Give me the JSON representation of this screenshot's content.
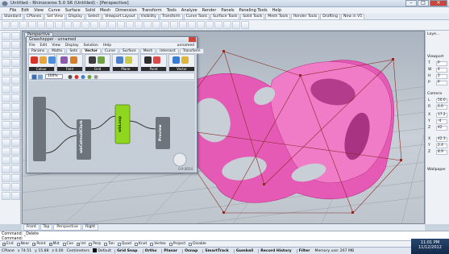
{
  "window": {
    "title": "Untitled - Rhinoceros 5.0 SR (Untitled) - [Perspective]",
    "controls": [
      "–",
      "□",
      "✕"
    ]
  },
  "menubar": [
    "File",
    "Edit",
    "View",
    "Curve",
    "Surface",
    "Solid",
    "Mesh",
    "Dimension",
    "Transform",
    "Tools",
    "Analyze",
    "Render",
    "Panels",
    "Paneling Tools",
    "Help"
  ],
  "toolbar_tabs": [
    "Standard",
    "CPlanes",
    "Set View",
    "Display",
    "Select",
    "Viewport Layout",
    "Visibility",
    "Transform",
    "Curve Tools",
    "Surface Tools",
    "Solid Tools",
    "Mesh Tools",
    "Render Tools",
    "Drafting",
    "New in V5"
  ],
  "toolbar_active_tab": "Set View",
  "viewport": {
    "label": "Perspective"
  },
  "grasshopper": {
    "title": "Grasshopper - unnamed",
    "menu": [
      "File",
      "Edit",
      "View",
      "Display",
      "Solution",
      "Help"
    ],
    "document": "unnamed",
    "tabs": [
      "Params",
      "Maths",
      "Sets",
      "Vector",
      "Curve",
      "Surface",
      "Mesh",
      "Intersect",
      "Transform"
    ],
    "active_tab": "Vector",
    "groups": [
      "Colour",
      "Field",
      "Grid",
      "Plane",
      "Point",
      "Vector"
    ],
    "zoom": "100%",
    "components": [
      "wbCatmullClark",
      "wbLoop",
      "Preview"
    ],
    "version": "0.9.0014"
  },
  "right_panel": {
    "header": "Laye...",
    "viewport_section": "Viewport",
    "camera_section": "Camera",
    "wallpaper_section": "Wallpaper",
    "fields": [
      {
        "label": "T",
        "value": "P"
      },
      {
        "label": "W",
        "value": "4"
      },
      {
        "label": "H",
        "value": "2"
      },
      {
        "label": "P",
        "value": "P"
      },
      {
        "label": "L",
        "value": "50.0"
      },
      {
        "label": "R",
        "value": "0.0"
      },
      {
        "label": "X",
        "value": "17.2"
      },
      {
        "label": "Y",
        "value": "-4"
      },
      {
        "label": "Z",
        "value": "42"
      },
      {
        "label": "X",
        "value": "42.3"
      },
      {
        "label": "Y",
        "value": "2.4"
      },
      {
        "label": "Z",
        "value": "8.9"
      }
    ]
  },
  "view_tabs": [
    "Front",
    "Top",
    "Perspective",
    "Right"
  ],
  "view_tabs_active": "Perspective",
  "command": {
    "line1": "Command: _Delete",
    "line2": "Command:"
  },
  "osnaps": [
    {
      "label": "End",
      "checked": true
    },
    {
      "label": "Near",
      "checked": false
    },
    {
      "label": "Point",
      "checked": true
    },
    {
      "label": "Mid",
      "checked": true
    },
    {
      "label": "Cen",
      "checked": false
    },
    {
      "label": "Int",
      "checked": true
    },
    {
      "label": "Perp",
      "checked": false
    },
    {
      "label": "Tan",
      "checked": false
    },
    {
      "label": "Quad",
      "checked": false
    },
    {
      "label": "Knot",
      "checked": false
    },
    {
      "label": "Vertex",
      "checked": false
    },
    {
      "label": "Project",
      "checked": false
    },
    {
      "label": "Disable",
      "checked": false
    }
  ],
  "status": {
    "cplane": "CPlane",
    "x": "x 74.51",
    "y": "y 15.88",
    "z": "z 0.00",
    "units": "Centimeters",
    "layer": "Default",
    "panes": [
      "Grid Snap",
      "Ortho",
      "Planar",
      "Osnap",
      "SmartTrack",
      "Gumball",
      "Record History",
      "Filter"
    ],
    "memory": "Memory use: 267 MB"
  },
  "taskbar": {
    "time": "11:01 PM",
    "date": "11/12/2012"
  },
  "colors": {
    "mesh_pink": "#e45ab4",
    "control_cage": "#8a2a2a",
    "component_green": "#8fd61f",
    "taskbar": "#1c3c63"
  }
}
